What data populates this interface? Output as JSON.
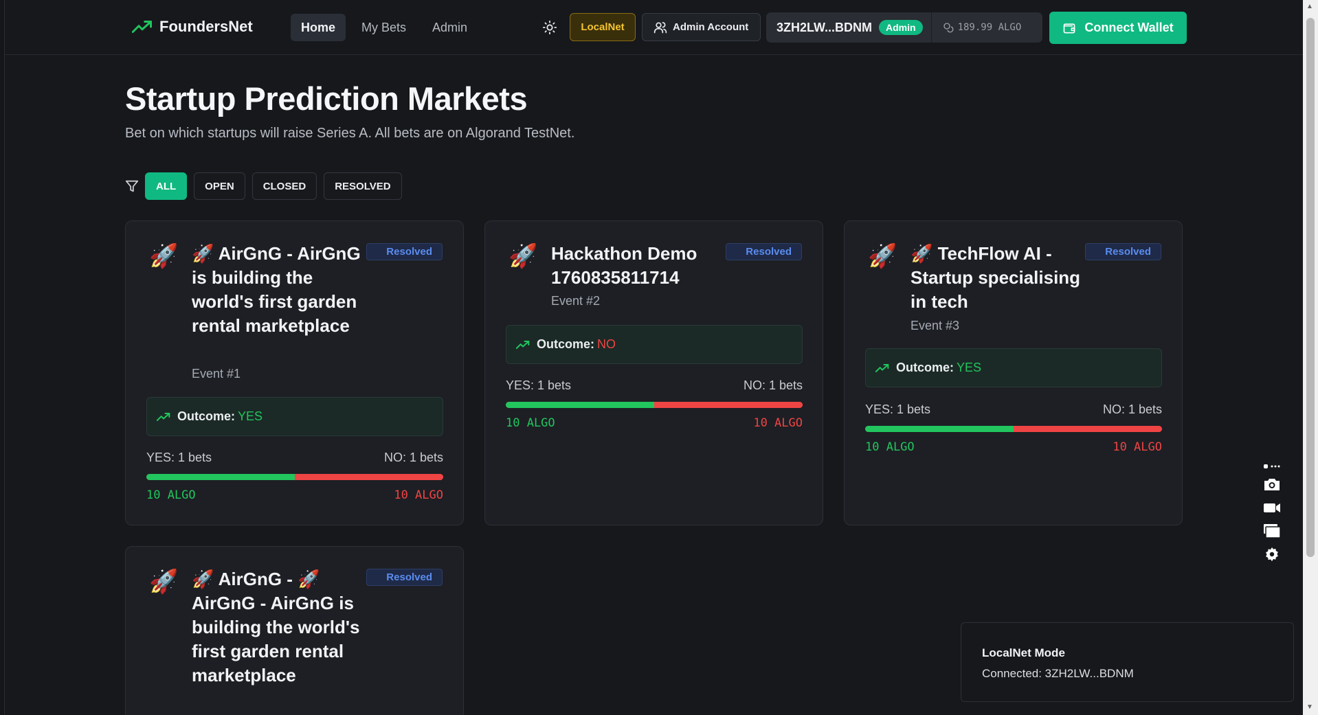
{
  "nav": {
    "brand": "FoundersNet",
    "links": [
      "Home",
      "My Bets",
      "Admin"
    ],
    "network_label": "LocalNet",
    "account_label": "Admin Account",
    "address": "3ZH2LW...BDNM",
    "address_badge": "Admin",
    "balance": "189.99 ALGO",
    "connect_label": "Connect Wallet"
  },
  "page": {
    "title": "Startup Prediction Markets",
    "subtitle": "Bet on which startups will raise Series A. All bets are on Algorand TestNet."
  },
  "filters": [
    "ALL",
    "OPEN",
    "CLOSED",
    "RESOLVED"
  ],
  "cards": [
    {
      "icon": "🚀",
      "title": "🚀 AirGnG - AirGnG is building the world's first garden rental marketplace",
      "event": "Event #1",
      "badge": "Resolved",
      "outcome_label": "Outcome:",
      "outcome": "YES",
      "yes_count": "YES: 1 bets",
      "no_count": "NO: 1 bets",
      "yes_amount": "10 ALGO",
      "no_amount": "10 ALGO",
      "yes_share": 0.5
    },
    {
      "icon": "🚀",
      "title": "Hackathon Demo 1760835811714",
      "event": "Event #2",
      "badge": "Resolved",
      "outcome_label": "Outcome:",
      "outcome": "NO",
      "yes_count": "YES: 1 bets",
      "no_count": "NO: 1 bets",
      "yes_amount": "10 ALGO",
      "no_amount": "10 ALGO",
      "yes_share": 0.5
    },
    {
      "icon": "🚀",
      "title": "🚀 TechFlow AI - Startup specialising in tech",
      "event": "Event #3",
      "badge": "Resolved",
      "outcome_label": "Outcome:",
      "outcome": "YES",
      "yes_count": "YES: 1 bets",
      "no_count": "NO: 1 bets",
      "yes_amount": "10 ALGO",
      "no_amount": "10 ALGO",
      "yes_share": 0.5
    },
    {
      "icon": "🚀",
      "title": "🚀 AirGnG - 🚀 AirGnG - AirGnG is building the world's first garden rental marketplace",
      "badge": "Resolved"
    }
  ],
  "toast": {
    "title": "LocalNet Mode",
    "message": "Connected: 3ZH2LW...BDNM"
  },
  "colors": {
    "accent": "#10b981",
    "yes": "#22c55e",
    "no": "#ef4444",
    "resolved": "#5b8cf0",
    "localnet": "#f4c430"
  }
}
